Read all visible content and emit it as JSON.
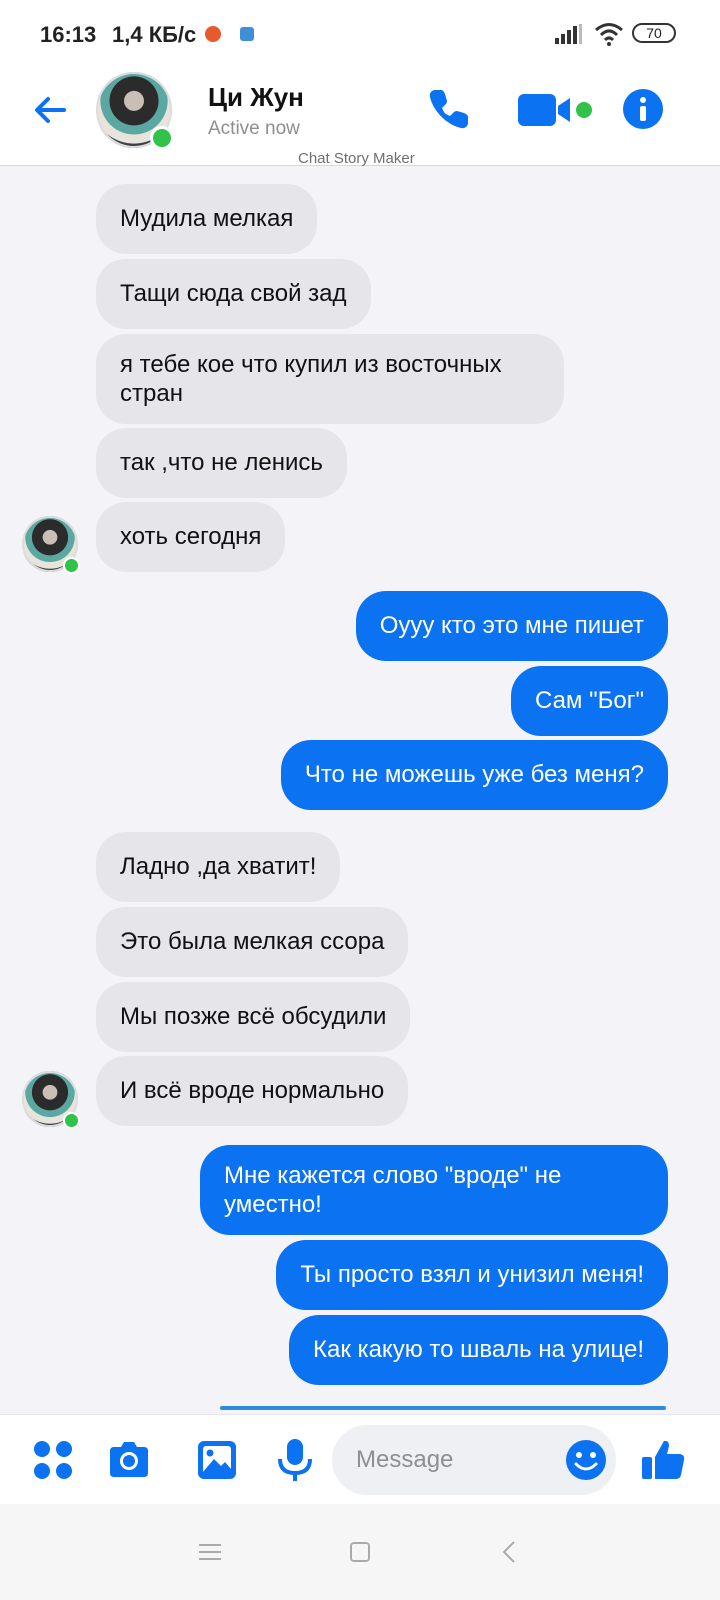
{
  "status_bar": {
    "time": "16:13",
    "network_speed": "1,4 КБ/с",
    "battery": "70"
  },
  "header": {
    "contact_name": "Ци Жун",
    "contact_status": "Active now",
    "watermark": "Chat Story Maker",
    "accent_color": "#0b72f2",
    "online_color": "#31c24a"
  },
  "messages": [
    {
      "side": "in",
      "text": "Мудила мелкая"
    },
    {
      "side": "in",
      "text": "Тащи сюда свой зад"
    },
    {
      "side": "in",
      "text": "я тебе кое что купил из восточных стран"
    },
    {
      "side": "in",
      "text": "так ,что не ленись"
    },
    {
      "side": "in",
      "text": "хоть сегодня"
    },
    {
      "side": "out",
      "text": "Оууу кто это мне пишет"
    },
    {
      "side": "out",
      "text": "Сам \"Бог\""
    },
    {
      "side": "out",
      "text": "Что не можешь уже без меня?"
    },
    {
      "side": "in",
      "text": "Ладно ,да хватит!"
    },
    {
      "side": "in",
      "text": "Это была мелкая ссора"
    },
    {
      "side": "in",
      "text": "Мы позже всё обсудили"
    },
    {
      "side": "in",
      "text": "И всё вроде нормально"
    },
    {
      "side": "out",
      "text": "Мне кажется слово \"вроде\" не уместно!"
    },
    {
      "side": "out",
      "text": "Ты просто взял и унизил меня!"
    },
    {
      "side": "out",
      "text": "Как какую то шваль на улице!"
    }
  ],
  "composer": {
    "placeholder": "Message",
    "icons": [
      "apps-icon",
      "camera-icon",
      "gallery-icon",
      "microphone-icon",
      "emoji-icon",
      "thumbs-up-icon"
    ]
  },
  "navbar": {
    "icons": [
      "menu-icon",
      "home-square-icon",
      "back-chevron-icon"
    ]
  }
}
